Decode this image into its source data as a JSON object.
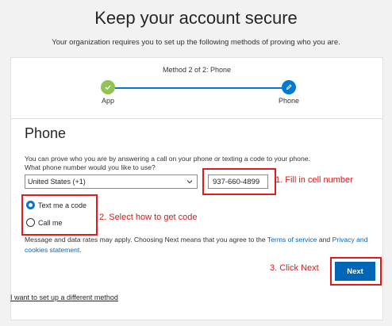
{
  "header": {
    "title": "Keep your account secure",
    "subtitle": "Your organization requires you to set up the following methods of proving who you are."
  },
  "progress": {
    "method_label": "Method 2 of 2: Phone",
    "steps": [
      {
        "label": "App",
        "state": "complete",
        "icon": "check-icon"
      },
      {
        "label": "Phone",
        "state": "current",
        "icon": "pencil-icon"
      }
    ],
    "colors": {
      "complete": "#92c353",
      "current": "#0078d4"
    }
  },
  "phone": {
    "section_title": "Phone",
    "description_line1": "You can prove who you are by answering a call on your phone or texting a code to your phone.",
    "description_line2": "What phone number would you like to use?",
    "country": "United States (+1)",
    "number": "937-660-4899",
    "options": [
      {
        "label": "Text me a code",
        "checked": true
      },
      {
        "label": "Call me",
        "checked": false
      }
    ],
    "consent_prefix": "Message and data rates may apply. Choosing Next means that you agree to the ",
    "terms_link": "Terms of service",
    "consent_and": " and ",
    "privacy_link": "Privacy and cookies statement.",
    "next_label": "Next"
  },
  "annotations": {
    "step1": "1. Fill in cell number",
    "step2": "2. Select how to get code",
    "step3": "3. Click Next",
    "color": "#e01b1b"
  },
  "footer": {
    "alt_method_link": "I want to set up a different method"
  }
}
